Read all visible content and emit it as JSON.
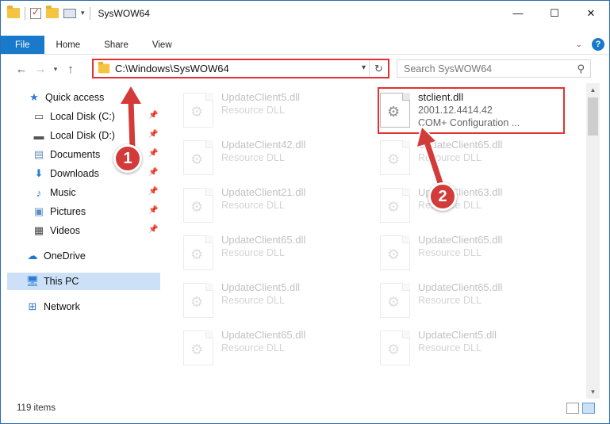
{
  "window": {
    "title": "SysWOW64",
    "controls": {
      "minimize": "—",
      "maximize": "☐",
      "close": "✕"
    }
  },
  "ribbon": {
    "tabs": [
      "File",
      "Home",
      "Share",
      "View"
    ]
  },
  "nav": {
    "address": "C:\\Windows\\SysWOW64",
    "search_placeholder": "Search SysWOW64"
  },
  "sidebar": {
    "items": [
      {
        "label": "Quick access",
        "icon": "star-icon"
      },
      {
        "label": "Local Disk (C:)",
        "icon": "drive-icon"
      },
      {
        "label": "Local Disk (D:)",
        "icon": "drive-icon"
      },
      {
        "label": "Documents",
        "icon": "documents-icon"
      },
      {
        "label": "Downloads",
        "icon": "download-icon"
      },
      {
        "label": "Music",
        "icon": "music-icon"
      },
      {
        "label": "Pictures",
        "icon": "pictures-icon"
      },
      {
        "label": "Videos",
        "icon": "videos-icon"
      },
      {
        "label": "OneDrive",
        "icon": "cloud-icon"
      },
      {
        "label": "This PC",
        "icon": "computer-icon"
      },
      {
        "label": "Network",
        "icon": "network-icon"
      }
    ]
  },
  "files": {
    "highlighted": {
      "name": "stclient.dll",
      "version": "2001.12.4414.42",
      "description": "COM+ Configuration ..."
    },
    "left": [
      {
        "name": "UpdateClient5.dll",
        "type": "Resource DLL"
      },
      {
        "name": "UpdateClient42.dll",
        "type": "Resource DLL"
      },
      {
        "name": "UpdateClient21.dll",
        "type": "Resource DLL"
      },
      {
        "name": "UpdateClient65.dll",
        "type": "Resource DLL"
      },
      {
        "name": "UpdateClient5.dll",
        "type": "Resource DLL"
      },
      {
        "name": "UpdateClient65.dll",
        "type": "Resource DLL"
      }
    ],
    "right": [
      {
        "name": "UpdateClient65.dll",
        "type": "Resource DLL"
      },
      {
        "name": "UpdateClient63.dll",
        "type": "Resource DLL"
      },
      {
        "name": "UpdateClient65.dll",
        "type": "Resource DLL"
      },
      {
        "name": "UpdateClient65.dll",
        "type": "Resource DLL"
      },
      {
        "name": "UpdateClient5.dll",
        "type": "Resource DLL"
      }
    ]
  },
  "status": {
    "item_count": "119 items"
  },
  "callouts": [
    "1",
    "2"
  ],
  "colors": {
    "accent": "#1979ca",
    "highlight": "#e23131",
    "callout": "#d33a3a"
  }
}
